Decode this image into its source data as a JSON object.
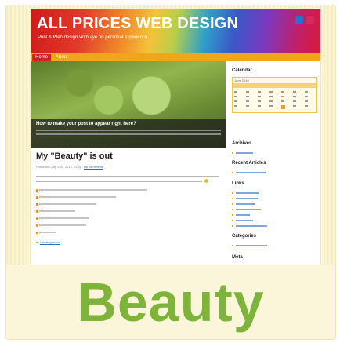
{
  "site": {
    "title": "ALL PRICES WEB DESIGN",
    "tagline": "Print & Web design With eye on personal experience",
    "nav": {
      "home": "Home",
      "about": "About"
    }
  },
  "hero": {
    "caption_title": "How to make your post to appear right here?"
  },
  "post": {
    "title": "My \"Beauty\" is out",
    "meta_date": "Published July 24th, 2010",
    "meta_author": "Lucy",
    "meta_comments": "No comments",
    "category_link": "Uncategorized",
    "intro": "I think summer is the greatest season! You could find all the impacts of colors there. It got inspired me to transpose the feeling to the next works, so here is my first take \"Beauty\"",
    "features": [
      "Featured posts teaser on \"sliderBanners\" (no plugins needed).",
      "Works fine under WordPress 3.0",
      "Threaded comments",
      "Options page",
      "Ready for localization",
      "Valid CSS & HTML",
      "GPL"
    ]
  },
  "sidebar": {
    "calendar_heading": "Calendar",
    "calendar_caption": "June 2010",
    "archives_heading": "Archives",
    "recent_heading": "Recent Articles",
    "links_heading": "Links",
    "categories_heading": "Categories",
    "meta_heading": "Meta"
  },
  "label": "Beauty",
  "colors": {
    "accent": "#7fb43a",
    "nav": "#f0a51a",
    "home": "#d62020"
  }
}
